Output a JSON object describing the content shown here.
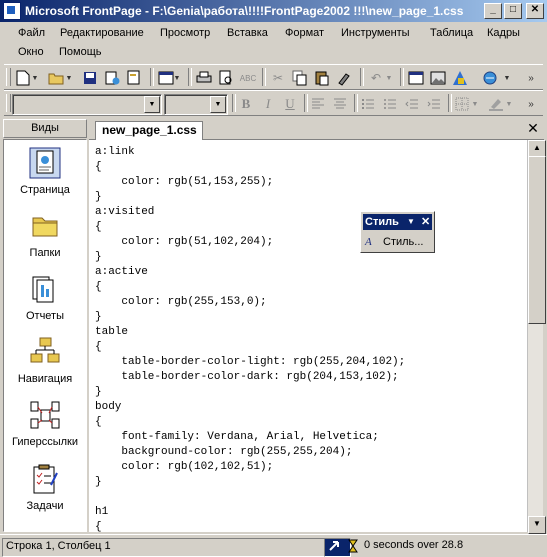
{
  "window": {
    "title": "Microsoft FrontPage - F:\\Genia\\работа\\!!!!FrontPage2002 !!!\\new_page_1.css",
    "minimize": "_",
    "maximize": "□",
    "close": "✕"
  },
  "menu": {
    "row1": [
      "Файл",
      "Редактирование",
      "Просмотр",
      "Вставка",
      "Формат",
      "Инструменты",
      "Таблица",
      "Кадры"
    ],
    "row2": [
      "Окно",
      "Помощь"
    ]
  },
  "toolbar_icons": [
    "new-icon",
    "open-icon",
    "save-icon",
    "publish-icon",
    "folder-list-icon",
    "views-icon",
    "print-icon",
    "print-preview-icon",
    "spelling-icon",
    "cut-icon",
    "copy-icon",
    "paste-icon",
    "format-painter-icon",
    "undo-icon",
    "table-icon",
    "picture-icon",
    "drawing-icon",
    "hyperlink-icon"
  ],
  "format_toolbar": {
    "style": "",
    "font": "",
    "bold": "B",
    "italic": "I",
    "underline": "U"
  },
  "views": {
    "header": "Виды",
    "items": [
      {
        "label": "Страница",
        "icon": "page-view-icon"
      },
      {
        "label": "Папки",
        "icon": "folders-view-icon"
      },
      {
        "label": "Отчеты",
        "icon": "reports-view-icon"
      },
      {
        "label": "Навигация",
        "icon": "navigation-view-icon"
      },
      {
        "label": "Гиперссылки",
        "icon": "hyperlinks-view-icon"
      },
      {
        "label": "Задачи",
        "icon": "tasks-view-icon"
      }
    ]
  },
  "document": {
    "tab": "new_page_1.css",
    "lines": [
      "a:link",
      "{",
      "    color: rgb(51,153,255);",
      "}",
      "a:visited",
      "{",
      "    color: rgb(51,102,204);",
      "}",
      "a:active",
      "{",
      "    color: rgb(255,153,0);",
      "}",
      "table",
      "{",
      "    table-border-color-light: rgb(255,204,102);",
      "    table-border-color-dark: rgb(204,153,102);",
      "}",
      "body",
      "{",
      "    font-family: Verdana, Arial, Helvetica;",
      "    background-color: rgb(255,255,204);",
      "    color: rgb(102,102,51);",
      "}",
      "",
      "h1",
      "{"
    ]
  },
  "style_toolbar": {
    "title": "Стиль",
    "button": "Стиль..."
  },
  "status": {
    "position": "Строка 1, Столбец 1",
    "download_time": "0 seconds over 28.8"
  },
  "colors": {
    "titlebar": "#0a246a",
    "face": "#d4d0c8"
  }
}
